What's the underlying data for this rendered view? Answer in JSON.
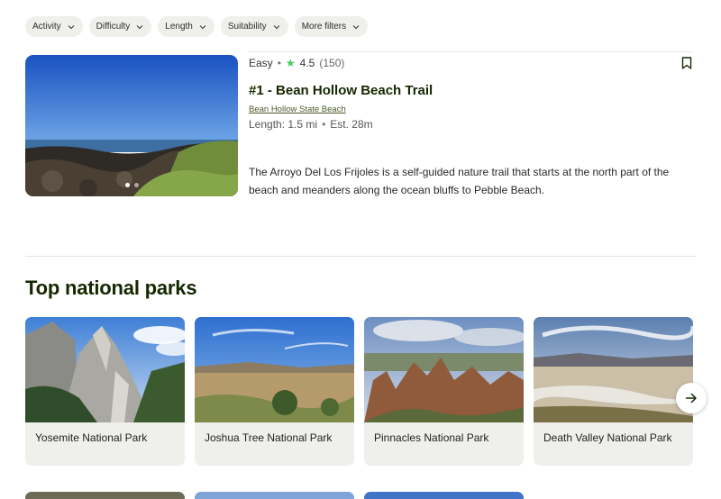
{
  "filters": [
    {
      "label": "Activity"
    },
    {
      "label": "Difficulty"
    },
    {
      "label": "Length"
    },
    {
      "label": "Suitability"
    },
    {
      "label": "More filters"
    }
  ],
  "trail": {
    "difficulty": "Easy",
    "rating": "4.5",
    "review_count": "(150)",
    "title": "#1 - Bean Hollow Beach Trail",
    "park": "Bean Hollow State Beach",
    "length": "Length: 1.5 mi",
    "est_time": "Est. 28m",
    "description": "The Arroyo Del Los Frijoles is a self-guided nature trail that starts at the north part of the beach and meanders along the ocean bluffs to Pebble Beach.",
    "photo_count": 2,
    "active_photo": 1
  },
  "section": {
    "title": "Top national parks"
  },
  "parks": [
    {
      "name": "Yosemite National Park"
    },
    {
      "name": "Joshua Tree National Park"
    },
    {
      "name": "Pinnacles National Park"
    },
    {
      "name": "Death Valley National Park"
    }
  ],
  "icons": {
    "filter_chevron": "chevron-down-icon",
    "rating_star": "star-icon",
    "save": "bookmark-icon",
    "next": "arrow-right-icon"
  },
  "colors": {
    "brand_dark": "#142800",
    "star": "#3ecf5a",
    "chip_bg": "#efefec"
  }
}
